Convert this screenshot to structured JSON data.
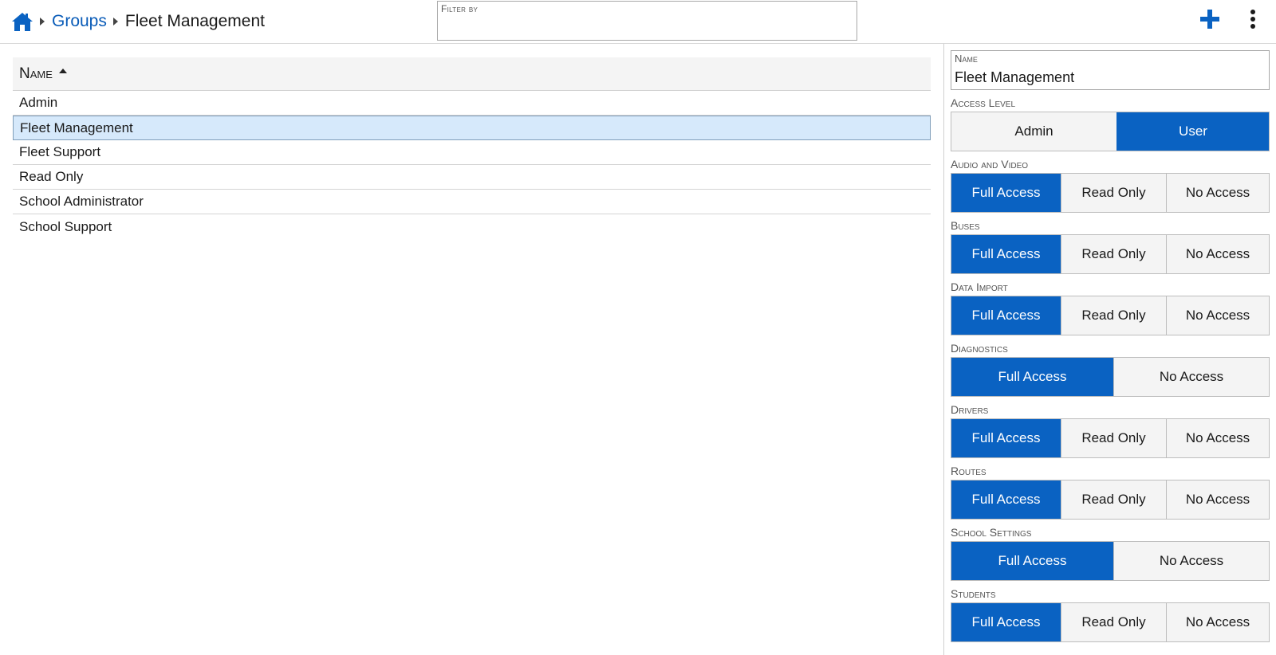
{
  "header": {
    "breadcrumb": {
      "home_icon": "home-icon",
      "groups": "Groups",
      "current": "Fleet Management"
    },
    "filter": {
      "label": "Filter by",
      "value": ""
    },
    "add_icon": "plus-icon",
    "more_icon": "more-vertical-icon",
    "accent_color": "#0a62c2"
  },
  "list": {
    "column_header": "Name",
    "sort": "ascending",
    "rows": [
      {
        "label": "Admin",
        "selected": false
      },
      {
        "label": "Fleet Management",
        "selected": true
      },
      {
        "label": "Fleet Support",
        "selected": false
      },
      {
        "label": "Read Only",
        "selected": false
      },
      {
        "label": "School Administrator",
        "selected": false
      },
      {
        "label": "School Support",
        "selected": false
      }
    ]
  },
  "detail": {
    "name_label": "Name",
    "name_value": "Fleet Management",
    "access_level": {
      "label": "Access Level",
      "options": [
        "Admin",
        "User"
      ],
      "selected": "User"
    },
    "permissions": [
      {
        "label": "Audio and Video",
        "options": [
          "Full Access",
          "Read Only",
          "No Access"
        ],
        "selected": "Full Access"
      },
      {
        "label": "Buses",
        "options": [
          "Full Access",
          "Read Only",
          "No Access"
        ],
        "selected": "Full Access"
      },
      {
        "label": "Data Import",
        "options": [
          "Full Access",
          "Read Only",
          "No Access"
        ],
        "selected": "Full Access"
      },
      {
        "label": "Diagnostics",
        "options": [
          "Full Access",
          "No Access"
        ],
        "selected": "Full Access"
      },
      {
        "label": "Drivers",
        "options": [
          "Full Access",
          "Read Only",
          "No Access"
        ],
        "selected": "Full Access"
      },
      {
        "label": "Routes",
        "options": [
          "Full Access",
          "Read Only",
          "No Access"
        ],
        "selected": "Full Access"
      },
      {
        "label": "School Settings",
        "options": [
          "Full Access",
          "No Access"
        ],
        "selected": "Full Access"
      },
      {
        "label": "Students",
        "options": [
          "Full Access",
          "Read Only",
          "No Access"
        ],
        "selected": "Full Access"
      }
    ]
  }
}
